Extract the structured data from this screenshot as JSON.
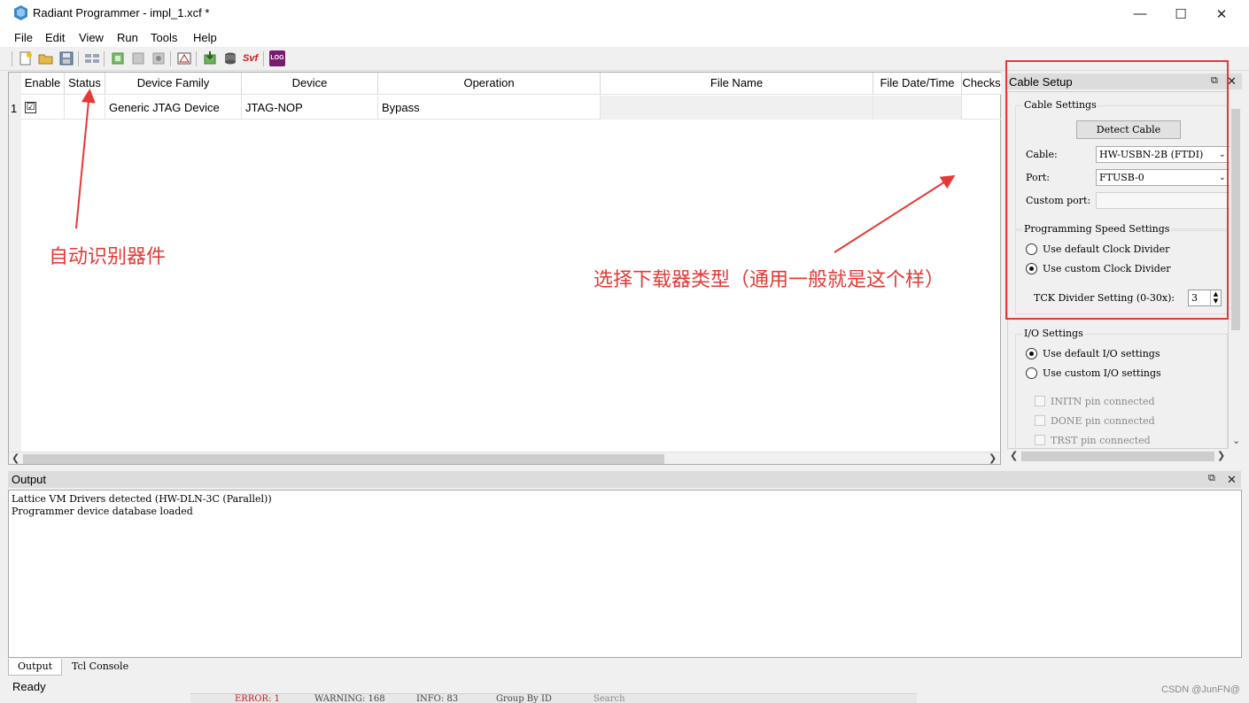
{
  "window": {
    "title": "Radiant Programmer - impl_1.xcf *",
    "controls": {
      "minimize": "—",
      "maximize": "☐",
      "close": "✕"
    }
  },
  "menu": [
    "File",
    "Edit",
    "View",
    "Run",
    "Tools",
    "Help"
  ],
  "toolbar": {
    "icons": [
      "new-file-icon",
      "open-folder-icon",
      "save-icon",
      "detect-devices-icon",
      "program-icon",
      "scan-icon",
      "settings-chip-icon",
      "ip-icon",
      "download-icon",
      "device-db-icon",
      "svf-icon",
      "log-icon"
    ],
    "svf_label": "Svf",
    "log_label": "LOG"
  },
  "table": {
    "columns": [
      "Enable",
      "Status",
      "Device Family",
      "Device",
      "Operation",
      "File Name",
      "File Date/Time",
      "Checks"
    ],
    "rows": [
      {
        "num": "1",
        "enable": "☑",
        "status": "",
        "family": "Generic JTAG Device",
        "device": "JTAG-NOP",
        "operation": "Bypass",
        "file_name": "",
        "file_date": "",
        "checksum": ""
      }
    ]
  },
  "cable_setup": {
    "title": "Cable Setup",
    "cable_settings": {
      "label": "Cable Settings",
      "detect_button": "Detect Cable",
      "cable_label": "Cable:",
      "cable_value": "HW-USBN-2B (FTDI)",
      "port_label": "Port:",
      "port_value": "FTUSB-0",
      "custom_port_label": "Custom port:",
      "custom_port_value": ""
    },
    "speed_settings": {
      "label": "Programming Speed Settings",
      "option_default": "Use default Clock Divider",
      "option_custom": "Use custom Clock Divider",
      "selected": "custom",
      "tck_label": "TCK Divider Setting (0-30x):",
      "tck_value": "3"
    },
    "io_settings": {
      "label": "I/O Settings",
      "option_default": "Use default I/O settings",
      "option_custom": "Use custom I/O settings",
      "selected": "default",
      "pins": [
        "INITN pin connected",
        "DONE pin connected",
        "TRST pin connected"
      ]
    }
  },
  "output": {
    "title": "Output",
    "lines": [
      "Lattice VM Drivers detected (HW-DLN-3C (Parallel))",
      "Programmer device database loaded"
    ],
    "tabs": [
      "Output",
      "Tcl Console"
    ]
  },
  "status": "Ready",
  "background_strip": [
    "ERROR: 1",
    "WARNING: 168",
    "INFO: 83",
    "Group By ID",
    "Search"
  ],
  "annotations": {
    "auto_detect": "自动识别器件",
    "cable_type": "选择下载器类型（通用一般就是这个样）"
  },
  "watermark": "CSDN @JunFN@",
  "colors": {
    "annotation": "#e53935",
    "panel_title": "#dcdcdc",
    "window_bg": "#f0f0f0"
  }
}
